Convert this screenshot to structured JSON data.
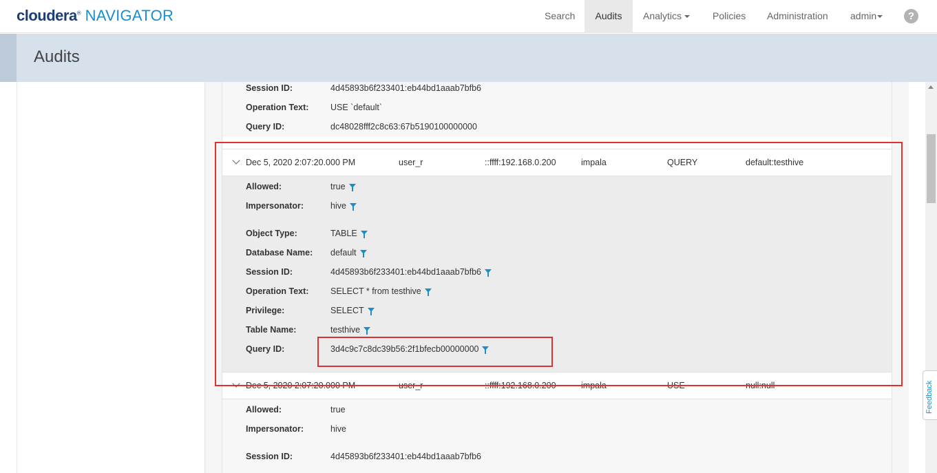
{
  "brand": {
    "name": "cloudera",
    "reg": "®",
    "product": "NAVIGATOR"
  },
  "nav": {
    "search": "Search",
    "audits": "Audits",
    "analytics": "Analytics",
    "policies": "Policies",
    "administration": "Administration",
    "user": "admin",
    "help": "?"
  },
  "page": {
    "title": "Audits"
  },
  "top_detail": [
    {
      "key": "Session ID:",
      "value": "4d45893b6f233401:eb44bd1aaab7bfb6"
    },
    {
      "key": "Operation Text:",
      "value": "USE `default`"
    },
    {
      "key": "Query ID:",
      "value": "dc48028fff2c8c63:67b5190100000000"
    }
  ],
  "event1": {
    "time": "Dec 5, 2020 2:07:20.000 PM",
    "user": "user_r",
    "ip": "::ffff:192.168.0.200",
    "service": "impala",
    "operation": "QUERY",
    "resource": "default:testhive",
    "details_a": [
      {
        "key": "Allowed:",
        "value": "true"
      },
      {
        "key": "Impersonator:",
        "value": "hive"
      }
    ],
    "details_b": [
      {
        "key": "Object Type:",
        "value": "TABLE"
      },
      {
        "key": "Database Name:",
        "value": "default"
      },
      {
        "key": "Session ID:",
        "value": "4d45893b6f233401:eb44bd1aaab7bfb6"
      },
      {
        "key": "Operation Text:",
        "value": "SELECT * from testhive"
      },
      {
        "key": "Privilege:",
        "value": "SELECT"
      },
      {
        "key": "Table Name:",
        "value": "testhive"
      },
      {
        "key": "Query ID:",
        "value": "3d4c9c7c8dc39b56:2f1bfecb00000000"
      }
    ]
  },
  "event2": {
    "time": "Dec 5, 2020 2:07:20.000 PM",
    "user": "user_r",
    "ip": "::ffff:192.168.0.200",
    "service": "impala",
    "operation": "USE",
    "resource": "null:null",
    "details_a": [
      {
        "key": "Allowed:",
        "value": "true"
      },
      {
        "key": "Impersonator:",
        "value": "hive"
      }
    ],
    "details_b": [
      {
        "key": "Session ID:",
        "value": "4d45893b6f233401:eb44bd1aaab7bfb6"
      }
    ]
  },
  "feedback": "Feedback",
  "colors": {
    "highlight": "#e03030",
    "accent": "#1a8fc9",
    "header_band": "#d6e1ec"
  }
}
